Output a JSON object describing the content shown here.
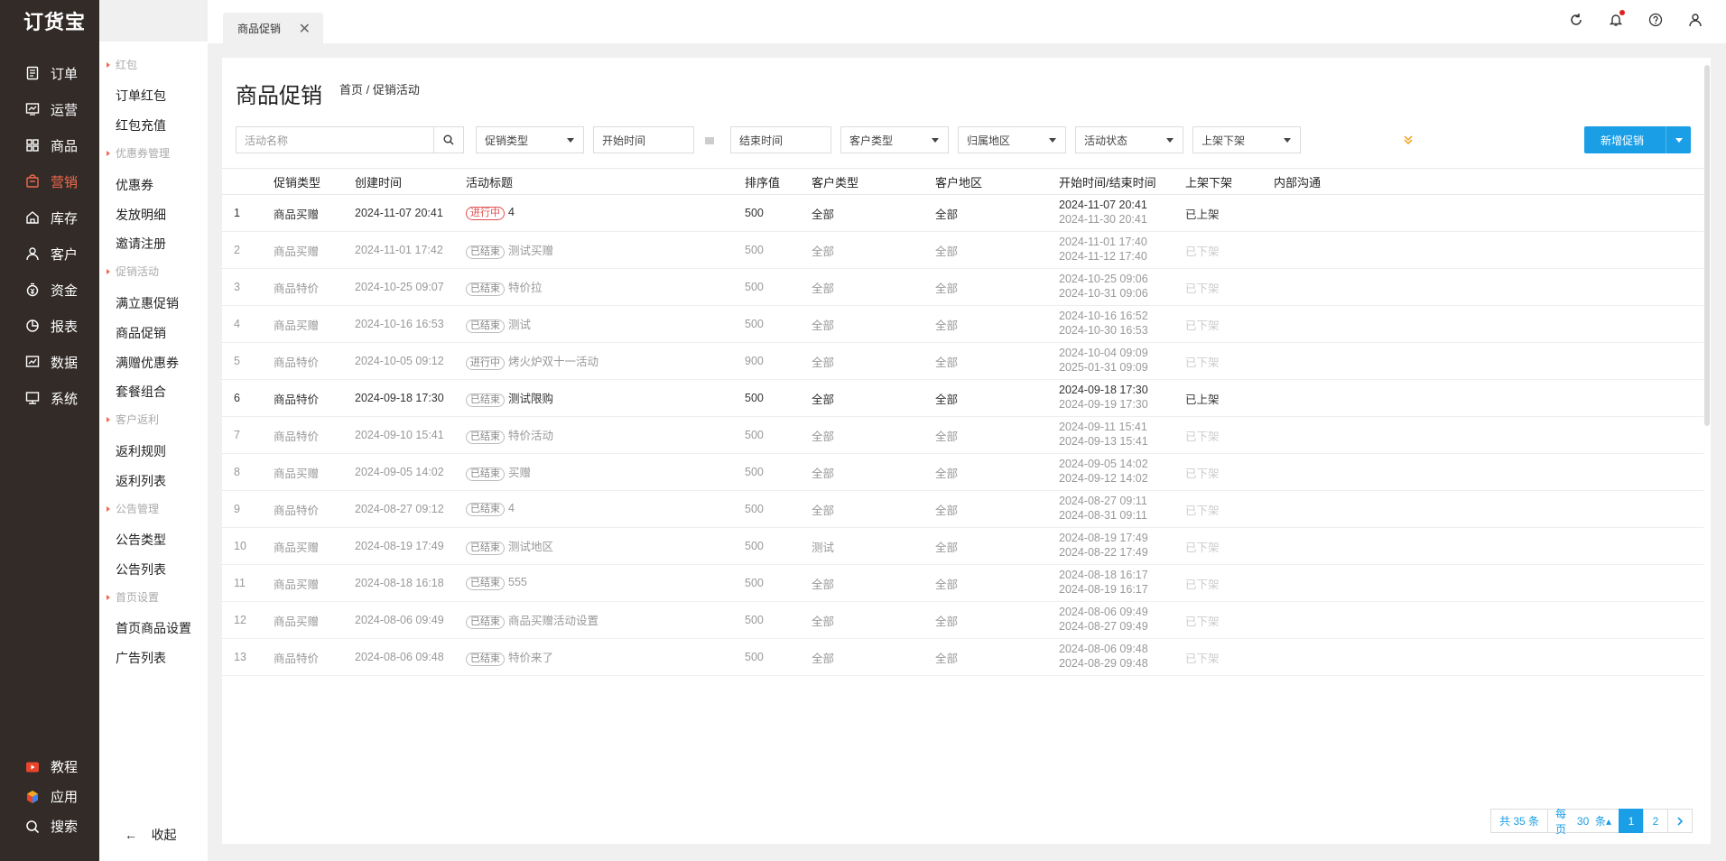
{
  "app": {
    "logo": "订货宝"
  },
  "nav": {
    "items": [
      {
        "label": "订单",
        "icon": "order-icon"
      },
      {
        "label": "运营",
        "icon": "operation-icon"
      },
      {
        "label": "商品",
        "icon": "goods-icon"
      },
      {
        "label": "营销",
        "icon": "marketing-icon",
        "active": true
      },
      {
        "label": "库存",
        "icon": "stock-icon"
      },
      {
        "label": "客户",
        "icon": "customer-icon"
      },
      {
        "label": "资金",
        "icon": "funds-icon"
      },
      {
        "label": "报表",
        "icon": "report-icon"
      },
      {
        "label": "数据",
        "icon": "data-icon"
      },
      {
        "label": "系统",
        "icon": "system-icon"
      }
    ],
    "bottom": [
      {
        "label": "教程",
        "icon": "tutorial-icon"
      },
      {
        "label": "应用",
        "icon": "app-icon"
      },
      {
        "label": "搜索",
        "icon": "search-icon"
      }
    ]
  },
  "subnav": {
    "groups": [
      "红包",
      "优惠券管理",
      "促销活动",
      "客户返利",
      "公告管理",
      "首页设置"
    ],
    "items": [
      "订单红包",
      "红包充值",
      "优惠券",
      "发放明细",
      "邀请注册",
      "满立惠促销",
      "商品促销",
      "满赠优惠券",
      "套餐组合",
      "返利规则",
      "返利列表",
      "公告类型",
      "公告列表",
      "首页商品设置",
      "广告列表"
    ],
    "collapse": "收起"
  },
  "tab": {
    "label": "商品促销"
  },
  "page": {
    "title": "商品促销",
    "breadcrumb": "首页 / 促销活动"
  },
  "filters": {
    "name_placeholder": "活动名称",
    "promo_type": "促销类型",
    "start": "开始时间",
    "end": "结束时间",
    "cust_type": "客户类型",
    "region": "归属地区",
    "status": "活动状态",
    "shelf": "上架下架",
    "add": "新增促销"
  },
  "table": {
    "headers": [
      "促销类型",
      "创建时间",
      "活动标题",
      "排序值",
      "客户类型",
      "客户地区",
      "开始时间/结束时间",
      "上架下架",
      "内部沟通"
    ],
    "rows": [
      {
        "no": "1",
        "type": "商品买赠",
        "created": "2024-11-07 20:41",
        "tag": "进行中",
        "title": "4",
        "sort": "500",
        "cust": "全部",
        "region": "全部",
        "start": "2024-11-07 20:41",
        "end": "2024-11-30 20:41",
        "shelf": "已上架",
        "live": true,
        "on": true
      },
      {
        "no": "2",
        "type": "商品买赠",
        "created": "2024-11-01 17:42",
        "tag": "已结束",
        "title": "测试买赠",
        "sort": "500",
        "cust": "全部",
        "region": "全部",
        "start": "2024-11-01 17:40",
        "end": "2024-11-12 17:40",
        "shelf": "已下架"
      },
      {
        "no": "3",
        "type": "商品特价",
        "created": "2024-10-25 09:07",
        "tag": "已结束",
        "title": "特价拉",
        "sort": "500",
        "cust": "全部",
        "region": "全部",
        "start": "2024-10-25 09:06",
        "end": "2024-10-31 09:06",
        "shelf": "已下架"
      },
      {
        "no": "4",
        "type": "商品买赠",
        "created": "2024-10-16 16:53",
        "tag": "已结束",
        "title": "测试",
        "sort": "500",
        "cust": "全部",
        "region": "全部",
        "start": "2024-10-16 16:52",
        "end": "2024-10-30 16:53",
        "shelf": "已下架"
      },
      {
        "no": "5",
        "type": "商品特价",
        "created": "2024-10-05 09:12",
        "tag": "进行中",
        "title": "烤火炉双十一活动",
        "sort": "900",
        "cust": "全部",
        "region": "全部",
        "start": "2024-10-04 09:09",
        "end": "2025-01-31 09:09",
        "shelf": "已下架"
      },
      {
        "no": "6",
        "type": "商品特价",
        "created": "2024-09-18 17:30",
        "tag": "已结束",
        "title": "测试限购",
        "sort": "500",
        "cust": "全部",
        "region": "全部",
        "start": "2024-09-18 17:30",
        "end": "2024-09-19 17:30",
        "shelf": "已上架",
        "on": true
      },
      {
        "no": "7",
        "type": "商品特价",
        "created": "2024-09-10 15:41",
        "tag": "已结束",
        "title": "特价活动",
        "sort": "500",
        "cust": "全部",
        "region": "全部",
        "start": "2024-09-11 15:41",
        "end": "2024-09-13 15:41",
        "shelf": "已下架"
      },
      {
        "no": "8",
        "type": "商品买赠",
        "created": "2024-09-05 14:02",
        "tag": "已结束",
        "title": "买赠",
        "sort": "500",
        "cust": "全部",
        "region": "全部",
        "start": "2024-09-05 14:02",
        "end": "2024-09-12 14:02",
        "shelf": "已下架"
      },
      {
        "no": "9",
        "type": "商品特价",
        "created": "2024-08-27 09:12",
        "tag": "已结束",
        "title": "4",
        "sort": "500",
        "cust": "全部",
        "region": "全部",
        "start": "2024-08-27 09:11",
        "end": "2024-08-31 09:11",
        "shelf": "已下架"
      },
      {
        "no": "10",
        "type": "商品买赠",
        "created": "2024-08-19 17:49",
        "tag": "已结束",
        "title": "测试地区",
        "sort": "500",
        "cust": "测试",
        "region": "全部",
        "start": "2024-08-19 17:49",
        "end": "2024-08-22 17:49",
        "shelf": "已下架"
      },
      {
        "no": "11",
        "type": "商品买赠",
        "created": "2024-08-18 16:18",
        "tag": "已结束",
        "title": "555",
        "sort": "500",
        "cust": "全部",
        "region": "全部",
        "start": "2024-08-18 16:17",
        "end": "2024-08-19 16:17",
        "shelf": "已下架"
      },
      {
        "no": "12",
        "type": "商品买赠",
        "created": "2024-08-06 09:49",
        "tag": "已结束",
        "title": "商品买赠活动设置",
        "sort": "500",
        "cust": "全部",
        "region": "全部",
        "start": "2024-08-06 09:49",
        "end": "2024-08-27 09:49",
        "shelf": "已下架"
      },
      {
        "no": "13",
        "type": "商品特价",
        "created": "2024-08-06 09:48",
        "tag": "已结束",
        "title": "特价来了",
        "sort": "500",
        "cust": "全部",
        "region": "全部",
        "start": "2024-08-06 09:48",
        "end": "2024-08-29 09:48",
        "shelf": "已下架"
      }
    ]
  },
  "pager": {
    "total": "共 35 条",
    "per_page": "每页",
    "per_page_value": "30",
    "per_page_unit": "条",
    "pages": [
      "1",
      "2"
    ],
    "current": "1"
  },
  "colors": {
    "sidebar": "#322b28",
    "accent": "#f06a4e",
    "primary": "#1a9ee6"
  }
}
